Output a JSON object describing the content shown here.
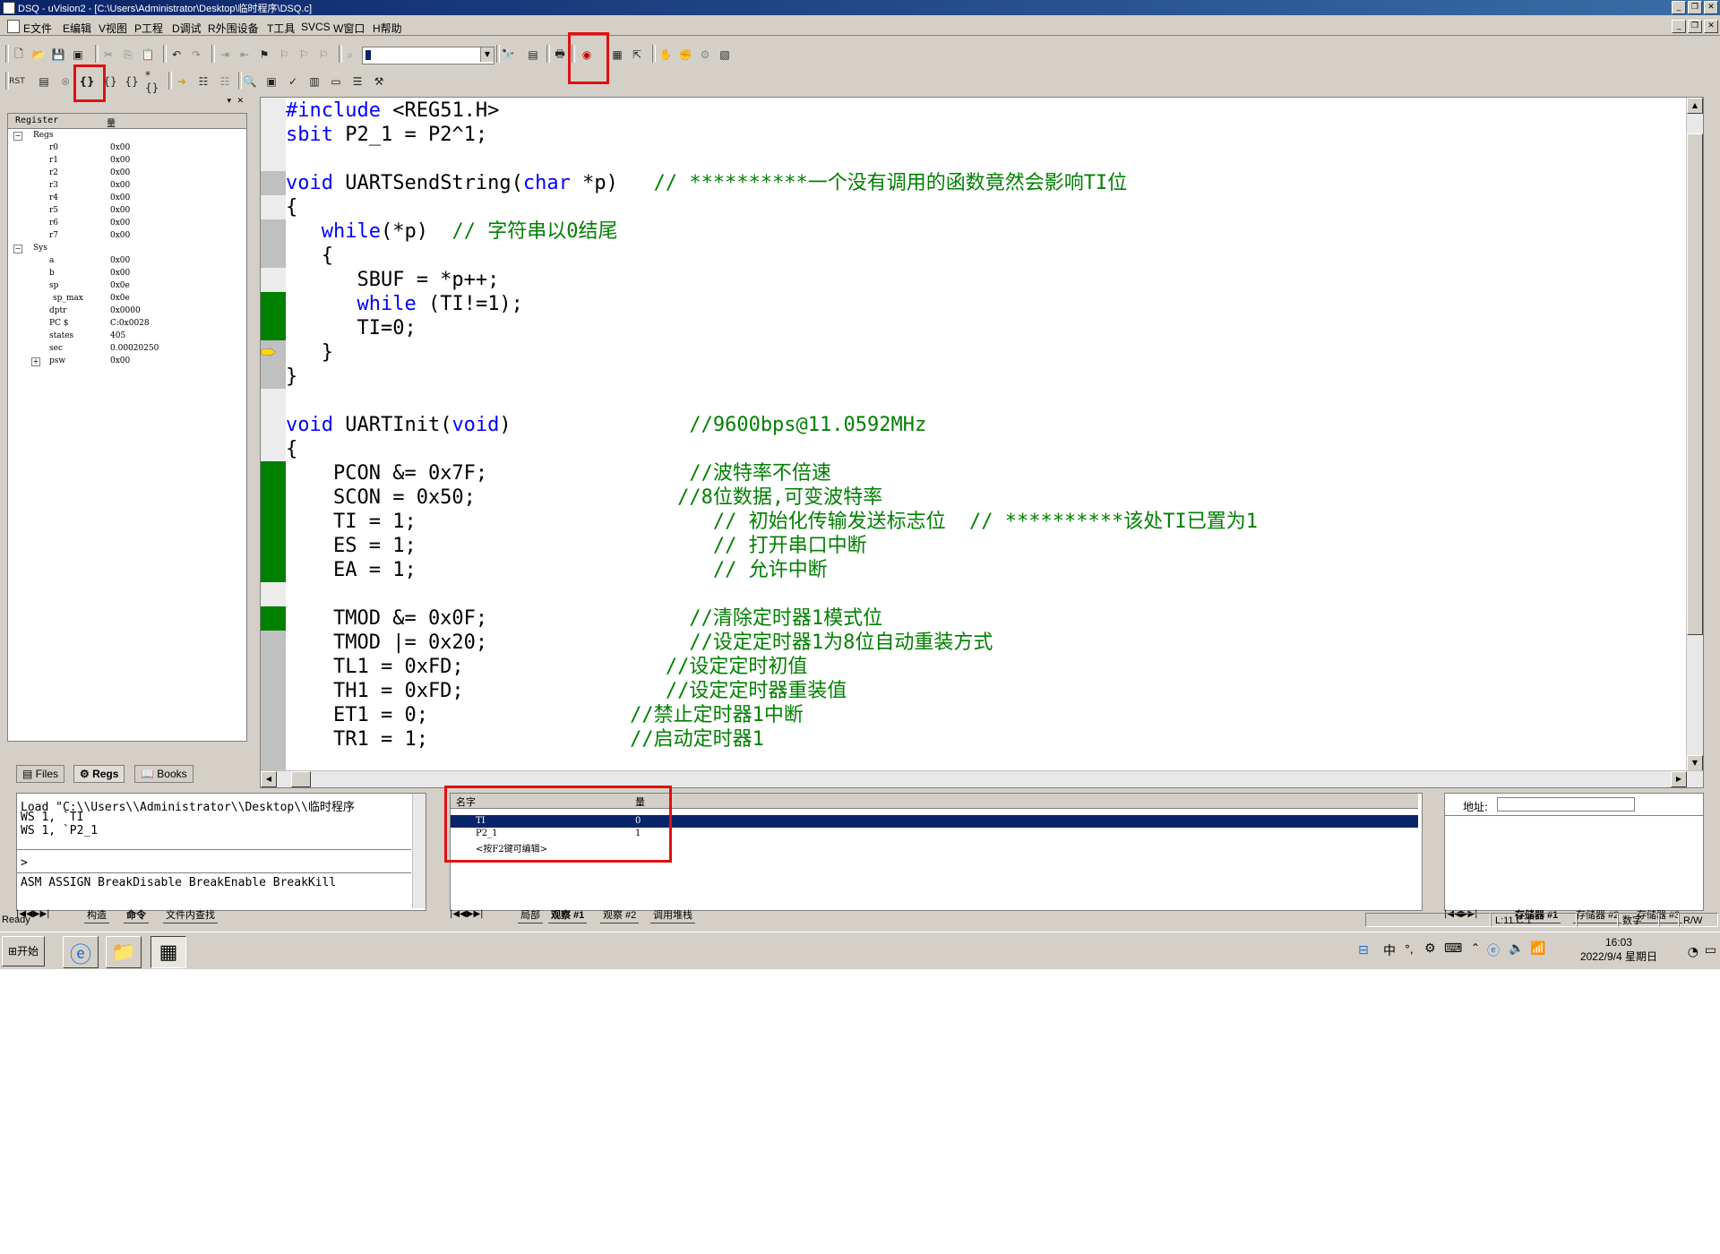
{
  "window": {
    "title": "DSQ - uVision2 - [C:\\Users\\Administrator\\Desktop\\临时程序\\DSQ.c]"
  },
  "menu": [
    "E文件",
    "E编辑",
    "V视图",
    "P工程",
    "D调试",
    "R外围设备",
    "T工具",
    "SVCS",
    "W窗口",
    "H帮助"
  ],
  "registers": {
    "header": {
      "name": "Register",
      "value": "量"
    },
    "groups": [
      {
        "label": "Regs",
        "items": [
          {
            "name": "r0",
            "value": "0x00"
          },
          {
            "name": "r1",
            "value": "0x00"
          },
          {
            "name": "r2",
            "value": "0x00"
          },
          {
            "name": "r3",
            "value": "0x00"
          },
          {
            "name": "r4",
            "value": "0x00"
          },
          {
            "name": "r5",
            "value": "0x00"
          },
          {
            "name": "r6",
            "value": "0x00"
          },
          {
            "name": "r7",
            "value": "0x00"
          }
        ]
      },
      {
        "label": "Sys",
        "items": [
          {
            "name": "a",
            "value": "0x00"
          },
          {
            "name": "b",
            "value": "0x00"
          },
          {
            "name": "sp",
            "value": "0x0e"
          },
          {
            "name": "sp_max",
            "value": "0x0e"
          },
          {
            "name": "dptr",
            "value": "0x0000"
          },
          {
            "name": "PC  $",
            "value": "C:0x0028"
          },
          {
            "name": "states",
            "value": "405"
          },
          {
            "name": "sec",
            "value": "0.00020250"
          },
          {
            "name": "psw",
            "value": "0x00"
          }
        ]
      }
    ]
  },
  "left_tabs": [
    "Files",
    "Regs",
    "Books"
  ],
  "code": [
    [
      [
        "kw",
        "#include"
      ],
      [
        "t",
        " <REG51.H>"
      ]
    ],
    [
      [
        "kw",
        "sbit"
      ],
      [
        "t",
        " P2_1 = P2^1;"
      ]
    ],
    [],
    [
      [
        "kw",
        "void"
      ],
      [
        "t",
        " UARTSendString("
      ],
      [
        "kw",
        "char"
      ],
      [
        "t",
        " *p)   "
      ],
      [
        "cm",
        "// **********一个没有调用的函数竟然会影响TI位"
      ]
    ],
    [
      [
        "t",
        "{"
      ]
    ],
    [
      [
        "t",
        "   "
      ],
      [
        "kw",
        "while"
      ],
      [
        "t",
        "(*p)  "
      ],
      [
        "cm",
        "// 字符串以0结尾"
      ]
    ],
    [
      [
        "t",
        "   {"
      ]
    ],
    [
      [
        "t",
        "      SBUF = *p++;"
      ]
    ],
    [
      [
        "t",
        "      "
      ],
      [
        "kw",
        "while"
      ],
      [
        "t",
        " (TI!=1);"
      ]
    ],
    [
      [
        "t",
        "      TI=0;"
      ]
    ],
    [
      [
        "t",
        "   }"
      ]
    ],
    [
      [
        "t",
        "}"
      ]
    ],
    [],
    [
      [
        "kw",
        "void"
      ],
      [
        "t",
        " UARTInit("
      ],
      [
        "kw",
        "void"
      ],
      [
        "t",
        ")               "
      ],
      [
        "cm",
        "//9600bps@11.0592MHz"
      ]
    ],
    [
      [
        "t",
        "{"
      ]
    ],
    [
      [
        "t",
        "    PCON &= 0x7F;                 "
      ],
      [
        "cm",
        "//波特率不倍速"
      ]
    ],
    [
      [
        "t",
        "    SCON = 0x50;                 "
      ],
      [
        "cm",
        "//8位数据,可变波特率"
      ]
    ],
    [
      [
        "t",
        "    TI = 1;                         "
      ],
      [
        "cm",
        "// 初始化传输发送标志位  // **********该处TI已置为1"
      ]
    ],
    [
      [
        "t",
        "    ES = 1;                         "
      ],
      [
        "cm",
        "// 打开串口中断"
      ]
    ],
    [
      [
        "t",
        "    EA = 1;                         "
      ],
      [
        "cm",
        "// 允许中断"
      ]
    ],
    [],
    [
      [
        "t",
        "    TMOD &= 0x0F;                 "
      ],
      [
        "cm",
        "//清除定时器1模式位"
      ]
    ],
    [
      [
        "t",
        "    TMOD |= 0x20;                 "
      ],
      [
        "cm",
        "//设定定时器1为8位自动重装方式"
      ]
    ],
    [
      [
        "t",
        "    TL1 = 0xFD;                 "
      ],
      [
        "cm",
        "//设定定时初值"
      ]
    ],
    [
      [
        "t",
        "    TH1 = 0xFD;                 "
      ],
      [
        "cm",
        "//设定定时器重装值"
      ]
    ],
    [
      [
        "t",
        "    ET1 = 0;                 "
      ],
      [
        "cm",
        "//禁止定时器1中断"
      ]
    ],
    [
      [
        "t",
        "    TR1 = 1;                 "
      ],
      [
        "cm",
        "//启动定时器1"
      ]
    ]
  ],
  "command_output": [
    "Load \"C:\\\\Users\\\\Administrator\\\\Desktop\\\\临时程序",
    "WS 1, `TI",
    "WS 1, `P2_1"
  ],
  "command_prompt": ">",
  "command_hint": "ASM ASSIGN BreakDisable BreakEnable BreakKill",
  "command_tabs": [
    "构造",
    "命令",
    "文件内查找"
  ],
  "watch": {
    "header": {
      "name": "名字",
      "value": "量"
    },
    "rows": [
      {
        "name": "TI",
        "value": "0"
      },
      {
        "name": "P2_1",
        "value": "1"
      },
      {
        "name": "<按F2键可编辑>",
        "value": ""
      }
    ],
    "tabs": [
      "局部",
      "观察 #1",
      "观察 #2",
      "调用堆栈"
    ]
  },
  "memory": {
    "address_label": "地址:",
    "address_value": "",
    "tabs": [
      "存储器 #1",
      "存储器 #2",
      "存储器 #3"
    ]
  },
  "status": {
    "text": "Ready",
    "position": "L:11 C:1",
    "num": "数字",
    "rw": "R/W"
  },
  "taskbar": {
    "start": "开始",
    "time": "16:03",
    "date": "2022/9/4 星期日"
  }
}
